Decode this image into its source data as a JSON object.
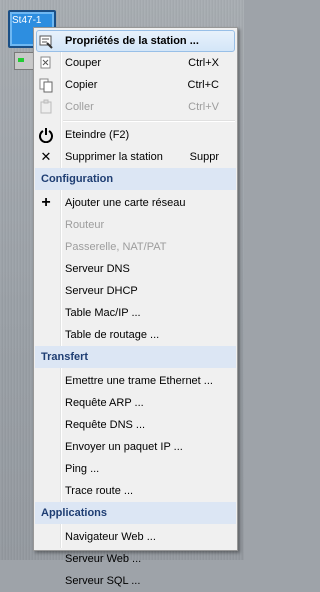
{
  "station": {
    "label": "St47-1"
  },
  "menu": {
    "top_items": [
      {
        "label": "Propriétés de la station ...",
        "shortcut": "",
        "icon": "properties-icon",
        "disabled": false,
        "highlight": true,
        "bold": true
      },
      {
        "label": "Couper",
        "shortcut": "Ctrl+X",
        "icon": "cut-icon",
        "disabled": false
      },
      {
        "label": "Copier",
        "shortcut": "Ctrl+C",
        "icon": "copy-icon",
        "disabled": false
      },
      {
        "label": "Coller",
        "shortcut": "Ctrl+V",
        "icon": "paste-icon",
        "disabled": true
      }
    ],
    "power_items": [
      {
        "label": "Eteindre  (F2)",
        "shortcut": "",
        "icon": "power-icon",
        "disabled": false
      },
      {
        "label": "Supprimer la station",
        "shortcut": "Suppr",
        "icon": "delete-icon",
        "disabled": false
      }
    ],
    "configuration": {
      "title": "Configuration",
      "items": [
        {
          "label": "Ajouter une carte réseau",
          "icon": "add-icon",
          "disabled": false
        },
        {
          "label": "Routeur",
          "disabled": true
        },
        {
          "label": "Passerelle, NAT/PAT",
          "disabled": true
        },
        {
          "label": "Serveur DNS",
          "disabled": false
        },
        {
          "label": "Serveur DHCP",
          "disabled": false
        },
        {
          "label": "Table Mac/IP ...",
          "disabled": false
        },
        {
          "label": "Table de routage ...",
          "disabled": false
        }
      ]
    },
    "transfert": {
      "title": "Transfert",
      "items": [
        {
          "label": "Emettre une trame Ethernet ...",
          "disabled": false
        },
        {
          "label": "Requête ARP ...",
          "disabled": false
        },
        {
          "label": "Requête DNS ...",
          "disabled": false
        },
        {
          "label": "Envoyer un paquet IP ...",
          "disabled": false
        },
        {
          "label": "Ping ...",
          "disabled": false
        },
        {
          "label": "Trace route ...",
          "disabled": false
        }
      ]
    },
    "applications": {
      "title": "Applications",
      "items": [
        {
          "label": "Navigateur Web ...",
          "disabled": false
        },
        {
          "label": "Serveur Web ...",
          "disabled": false
        },
        {
          "label": "Serveur SQL ...",
          "disabled": false
        }
      ]
    }
  }
}
